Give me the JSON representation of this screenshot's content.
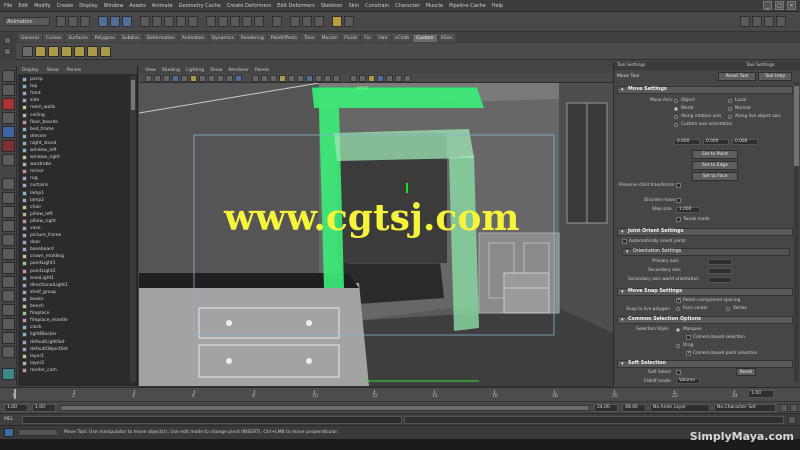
{
  "app": {
    "menus": [
      "File",
      "Edit",
      "Modify",
      "Create",
      "Display",
      "Window",
      "Assets",
      "Animate",
      "Geometry Cache",
      "Create Deformers",
      "Edit Deformers",
      "Skeleton",
      "Skin",
      "Constrain",
      "Character",
      "Muscle",
      "Pipeline Cache",
      "Help"
    ],
    "window_controls": [
      "_",
      "□",
      "×"
    ]
  },
  "status_line": {
    "mode": "Animation"
  },
  "shelf": {
    "tabs": [
      "General",
      "Curves",
      "Surfaces",
      "Polygons",
      "Subdivs",
      "Deformation",
      "Animation",
      "Dynamics",
      "Rendering",
      "PaintEffects",
      "Toon",
      "Muscle",
      "Fluids",
      "Fur",
      "Hair",
      "nCloth",
      "Custom",
      "XGen"
    ],
    "active_tab": "Custom"
  },
  "outliner": {
    "menu": [
      "Display",
      "Show",
      "Panels"
    ],
    "rows": [
      "persp",
      "top",
      "front",
      "side",
      "room_walls",
      "ceiling",
      "floor_boards",
      "bed_frame",
      "dresser",
      "night_stand",
      "window_left",
      "window_right",
      "wardrobe",
      "mirror",
      "rug",
      "curtains",
      "lamp1",
      "lamp2",
      "chair",
      "pillow_left",
      "pillow_right",
      "vase",
      "picture_frame",
      "door",
      "baseboard",
      "crown_molding",
      "pointLight1",
      "pointLight2",
      "areaLight1",
      "directionalLight1",
      "shelf_group",
      "books",
      "bench",
      "fireplace",
      "fireplace_mantle",
      "clock",
      "lightBlocker",
      "defaultLightSet",
      "defaultObjectSet",
      "layer1",
      "layer2",
      "render_cam"
    ]
  },
  "viewport": {
    "menu": [
      "View",
      "Shading",
      "Lighting",
      "Show",
      "Renderer",
      "Panels"
    ],
    "hud_label": "persp"
  },
  "attribute_editor": {
    "header_left": "Tool Settings",
    "header_right": "Tool Settings",
    "tool_name": "Move Tool",
    "reset_label": "Reset Tool",
    "help_label": "Tool Help",
    "sections": {
      "move": "Move Settings",
      "joint": "Joint Orient Settings",
      "snap": "Move Snap Settings",
      "common": "Common Selection Options",
      "soft": "Soft Selection"
    },
    "move_axis_label": "Move Axis:",
    "move_axes": [
      "Object",
      "Local",
      "World",
      "Normal",
      "Along rotation axis",
      "Along live object axis",
      "Custom axis orientation"
    ],
    "xyz_values": [
      "0.000",
      "0.000",
      "0.000"
    ],
    "point_buttons": [
      "Set to Point",
      "Set to Edge",
      "Set to Face"
    ],
    "fields": [
      "Preserve child transforms",
      "Discrete move",
      "Step size",
      "Tweak mode"
    ],
    "step_value": "1.000",
    "joint_option": "Automatically orient joints",
    "joint_sub": "Orientation Settings",
    "joint_fields": [
      "Primary axis",
      "Secondary axis",
      "Secondary axis world orientation"
    ],
    "snap_options": [
      "Retain component spacing",
      "Snap to live polygon",
      "Face center",
      "Vertex"
    ],
    "select_mode_label": "Selection Style:",
    "select_modes": [
      "Marquee",
      "Camera based selection",
      "Drag",
      "Camera based paint selection"
    ],
    "soft_select_label": "Soft Select",
    "soft_falloff_label": "Falloff mode:",
    "soft_falloff": "Volume",
    "reset_small": "Reset"
  },
  "timeline": {
    "ticks": [
      "1",
      "2",
      "4",
      "6",
      "8",
      "10",
      "12",
      "14",
      "16",
      "18",
      "20",
      "22",
      "24"
    ],
    "current_time": "1.00"
  },
  "range": {
    "start": "1.00",
    "start2": "1.00",
    "end": "24.00",
    "end2": "48.00",
    "anim_layer": "No Anim Layer",
    "char_set": "No Character Set"
  },
  "command_line": {
    "lang": "MEL"
  },
  "help_line": {
    "text": "Move Tool: Use manipulator to move object(s). Use edit mode to change pivot (INSERT). Ctrl+LMB to move perpendicular."
  },
  "watermark": "www.cgtsj.com",
  "brand": "SimplyMaya.com"
}
